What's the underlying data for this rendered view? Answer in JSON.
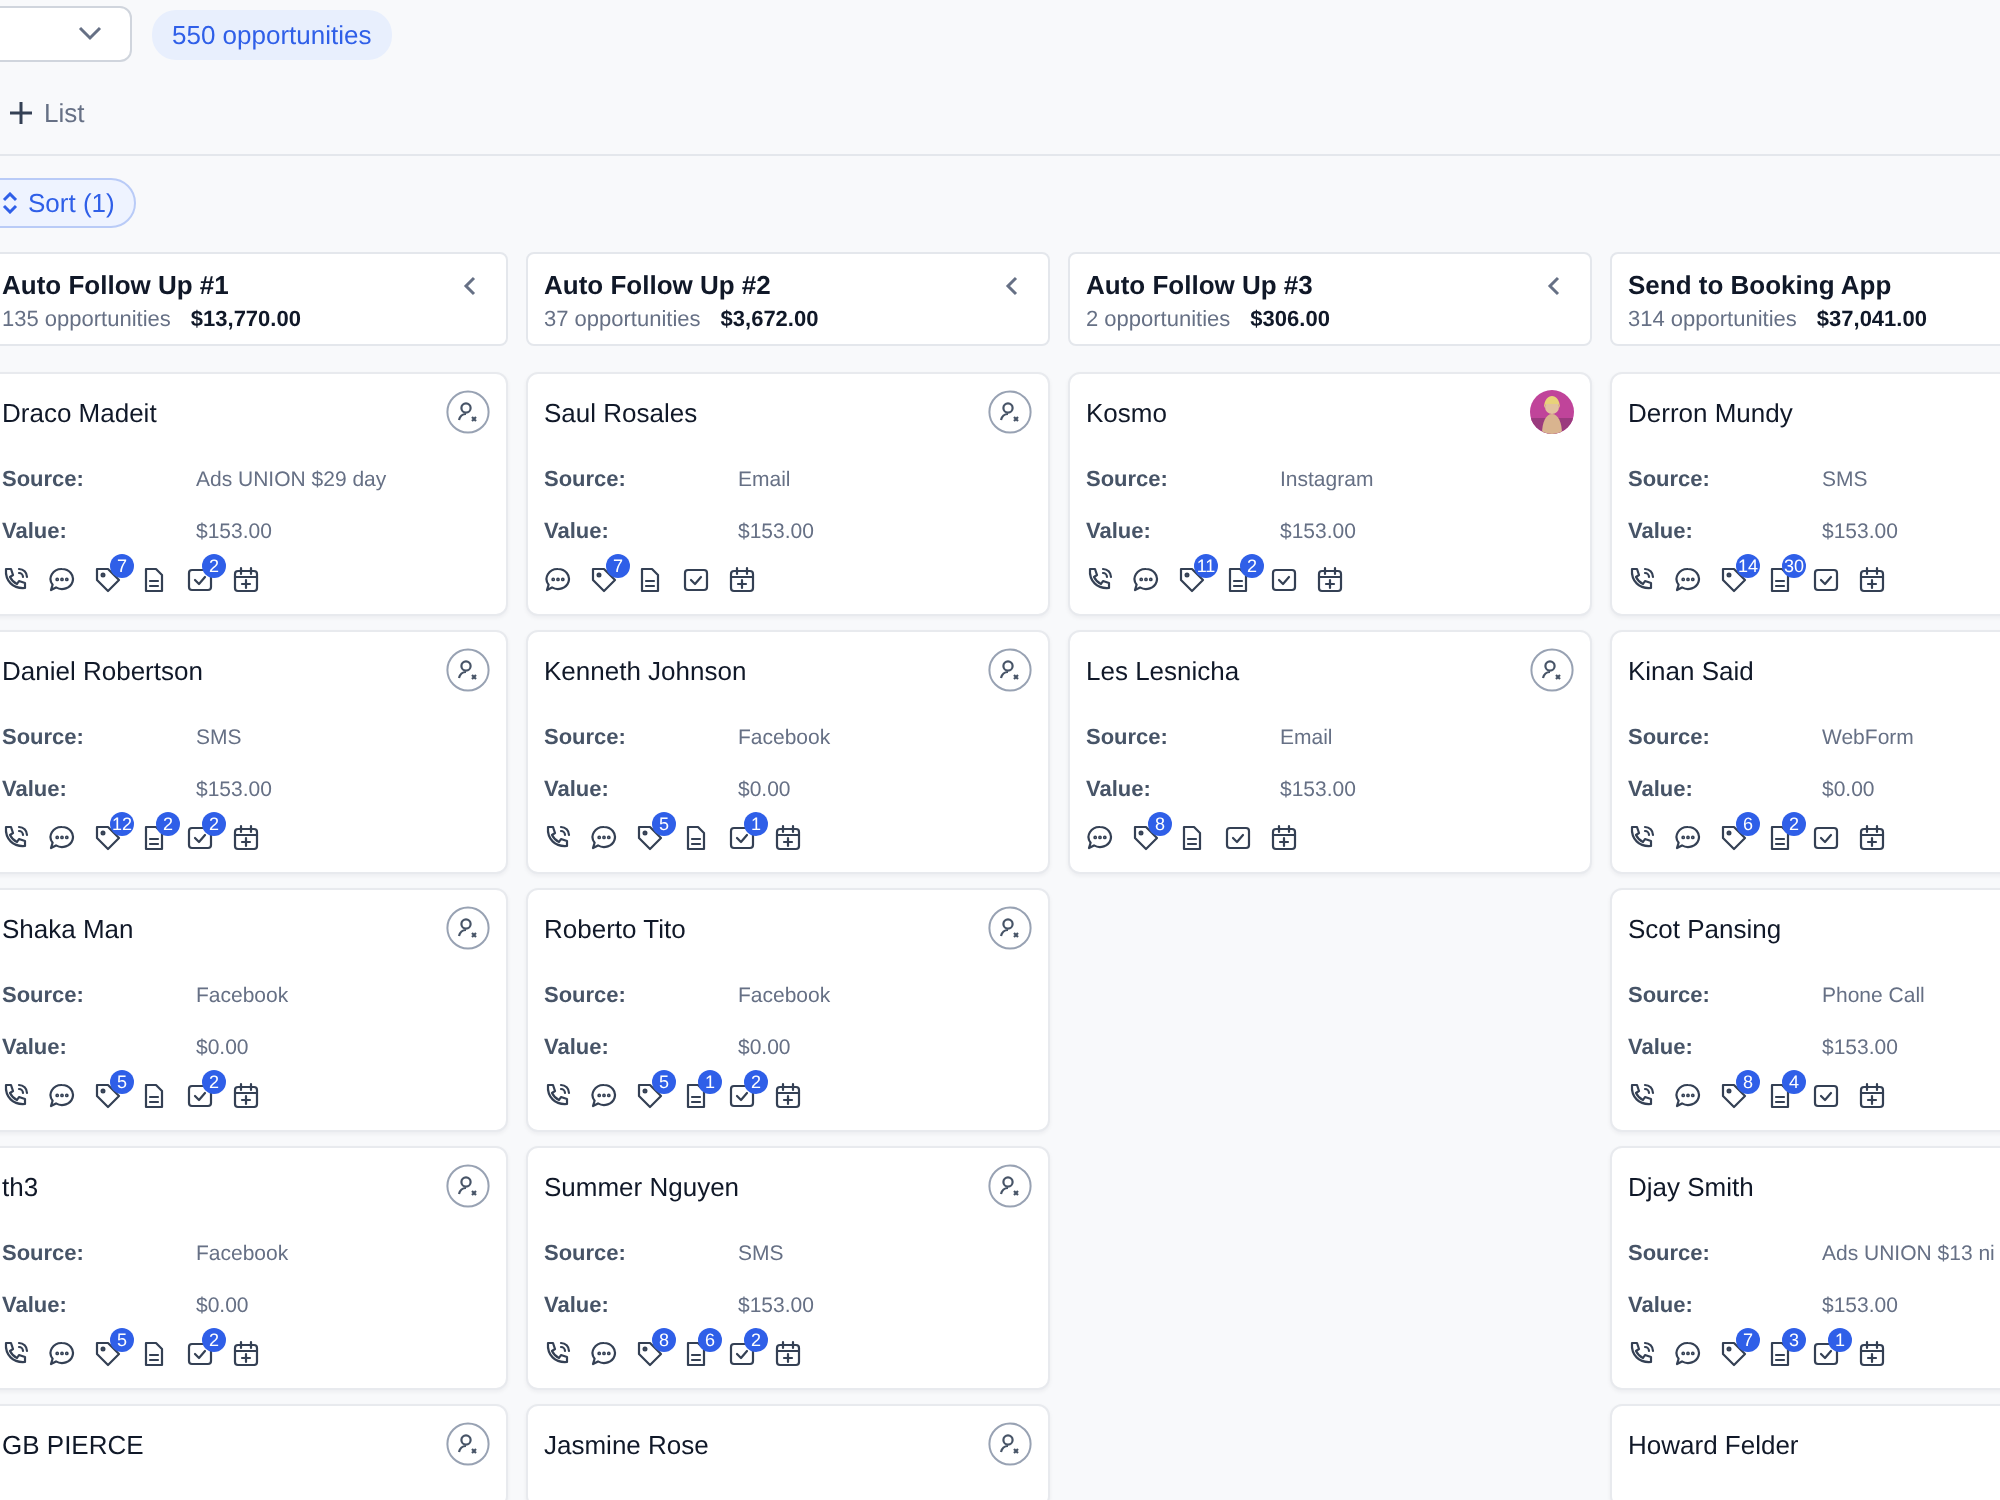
{
  "toolbar": {
    "count_badge": "550 opportunities",
    "add_list": "List",
    "sort": "Sort (1)"
  },
  "columns": [
    {
      "title": "Auto Follow Up #1",
      "count": "135 opportunities",
      "amount": "$13,770.00",
      "cards": [
        {
          "name": "Draco Madeit",
          "avatar": {
            "kind": "assign"
          },
          "source_label": "Source:",
          "source": "Ads UNION $29 day",
          "value_label": "Value:",
          "value": "$153.00",
          "actions": [
            {
              "kind": "phone"
            },
            {
              "kind": "chat"
            },
            {
              "kind": "tag",
              "badge": "7"
            },
            {
              "kind": "note"
            },
            {
              "kind": "task",
              "badge": "2"
            },
            {
              "kind": "calendar"
            }
          ]
        },
        {
          "name": "Daniel Robertson",
          "avatar": {
            "kind": "assign"
          },
          "source_label": "Source:",
          "source": "SMS",
          "value_label": "Value:",
          "value": "$153.00",
          "actions": [
            {
              "kind": "phone"
            },
            {
              "kind": "chat"
            },
            {
              "kind": "tag",
              "badge": "12"
            },
            {
              "kind": "note",
              "badge": "2"
            },
            {
              "kind": "task",
              "badge": "2"
            },
            {
              "kind": "calendar"
            }
          ]
        },
        {
          "name": "Shaka Man",
          "avatar": {
            "kind": "assign"
          },
          "source_label": "Source:",
          "source": "Facebook",
          "value_label": "Value:",
          "value": "$0.00",
          "actions": [
            {
              "kind": "phone"
            },
            {
              "kind": "chat"
            },
            {
              "kind": "tag",
              "badge": "5"
            },
            {
              "kind": "note"
            },
            {
              "kind": "task",
              "badge": "2"
            },
            {
              "kind": "calendar"
            }
          ]
        },
        {
          "name": "th3",
          "avatar": {
            "kind": "assign"
          },
          "source_label": "Source:",
          "source": "Facebook",
          "value_label": "Value:",
          "value": "$0.00",
          "actions": [
            {
              "kind": "phone"
            },
            {
              "kind": "chat"
            },
            {
              "kind": "tag",
              "badge": "5"
            },
            {
              "kind": "note"
            },
            {
              "kind": "task",
              "badge": "2"
            },
            {
              "kind": "calendar"
            }
          ]
        },
        {
          "name": "GB PIERCE",
          "avatar": {
            "kind": "assign"
          }
        }
      ]
    },
    {
      "title": "Auto Follow Up #2",
      "count": "37 opportunities",
      "amount": "$3,672.00",
      "cards": [
        {
          "name": "Saul Rosales",
          "avatar": {
            "kind": "assign"
          },
          "source_label": "Source:",
          "source": "Email",
          "value_label": "Value:",
          "value": "$153.00",
          "actions": [
            {
              "kind": "chat"
            },
            {
              "kind": "tag",
              "badge": "7"
            },
            {
              "kind": "note"
            },
            {
              "kind": "task"
            },
            {
              "kind": "calendar"
            }
          ]
        },
        {
          "name": "Kenneth Johnson",
          "avatar": {
            "kind": "assign"
          },
          "source_label": "Source:",
          "source": "Facebook",
          "value_label": "Value:",
          "value": "$0.00",
          "actions": [
            {
              "kind": "phone"
            },
            {
              "kind": "chat"
            },
            {
              "kind": "tag",
              "badge": "5"
            },
            {
              "kind": "note"
            },
            {
              "kind": "task",
              "badge": "1"
            },
            {
              "kind": "calendar"
            }
          ]
        },
        {
          "name": "Roberto Tito",
          "avatar": {
            "kind": "assign"
          },
          "source_label": "Source:",
          "source": "Facebook",
          "value_label": "Value:",
          "value": "$0.00",
          "actions": [
            {
              "kind": "phone"
            },
            {
              "kind": "chat"
            },
            {
              "kind": "tag",
              "badge": "5"
            },
            {
              "kind": "note",
              "badge": "1"
            },
            {
              "kind": "task",
              "badge": "2"
            },
            {
              "kind": "calendar"
            }
          ]
        },
        {
          "name": "Summer Nguyen",
          "avatar": {
            "kind": "assign"
          },
          "source_label": "Source:",
          "source": "SMS",
          "value_label": "Value:",
          "value": "$153.00",
          "actions": [
            {
              "kind": "phone"
            },
            {
              "kind": "chat"
            },
            {
              "kind": "tag",
              "badge": "8"
            },
            {
              "kind": "note",
              "badge": "6"
            },
            {
              "kind": "task",
              "badge": "2"
            },
            {
              "kind": "calendar"
            }
          ]
        },
        {
          "name": "Jasmine Rose",
          "avatar": {
            "kind": "assign"
          }
        }
      ]
    },
    {
      "title": "Auto Follow Up #3",
      "count": "2 opportunities",
      "amount": "$306.00",
      "cards": [
        {
          "name": "Kosmo",
          "source_label": "Source:",
          "source": "Instagram",
          "value_label": "Value:",
          "value": "$153.00",
          "actions": [
            {
              "kind": "phone"
            },
            {
              "kind": "chat"
            },
            {
              "kind": "tag",
              "badge": "11"
            },
            {
              "kind": "note",
              "badge": "2"
            },
            {
              "kind": "task"
            },
            {
              "kind": "calendar"
            }
          ]
        },
        {
          "name": "Les Lesnicha",
          "avatar": {
            "kind": "assign"
          },
          "source_label": "Source:",
          "source": "Email",
          "value_label": "Value:",
          "value": "$153.00",
          "actions": [
            {
              "kind": "chat"
            },
            {
              "kind": "tag",
              "badge": "8"
            },
            {
              "kind": "note"
            },
            {
              "kind": "task"
            },
            {
              "kind": "calendar"
            }
          ]
        }
      ]
    },
    {
      "title": "Send to Booking App",
      "count": "314 opportunities",
      "amount": "$37,041.00",
      "cards": [
        {
          "name": "Derron Mundy",
          "source_label": "Source:",
          "source": "SMS",
          "value_label": "Value:",
          "value": "$153.00",
          "actions": [
            {
              "kind": "phone"
            },
            {
              "kind": "chat"
            },
            {
              "kind": "tag",
              "badge": "14"
            },
            {
              "kind": "note",
              "badge": "30"
            },
            {
              "kind": "task"
            },
            {
              "kind": "calendar"
            }
          ]
        },
        {
          "name": "Kinan Said",
          "source_label": "Source:",
          "source": "WebForm",
          "value_label": "Value:",
          "value": "$0.00",
          "actions": [
            {
              "kind": "phone"
            },
            {
              "kind": "chat"
            },
            {
              "kind": "tag",
              "badge": "6"
            },
            {
              "kind": "note",
              "badge": "2"
            },
            {
              "kind": "task"
            },
            {
              "kind": "calendar"
            }
          ]
        },
        {
          "name": "Scot Pansing",
          "source_label": "Source:",
          "source": "Phone Call",
          "value_label": "Value:",
          "value": "$153.00",
          "actions": [
            {
              "kind": "phone"
            },
            {
              "kind": "chat"
            },
            {
              "kind": "tag",
              "badge": "8"
            },
            {
              "kind": "note",
              "badge": "4"
            },
            {
              "kind": "task"
            },
            {
              "kind": "calendar"
            }
          ]
        },
        {
          "name": "Djay Smith",
          "source_label": "Source:",
          "source": "Ads UNION $13 ni",
          "value_label": "Value:",
          "value": "$153.00",
          "actions": [
            {
              "kind": "phone"
            },
            {
              "kind": "chat"
            },
            {
              "kind": "tag",
              "badge": "7"
            },
            {
              "kind": "note",
              "badge": "3"
            },
            {
              "kind": "task",
              "badge": "1"
            },
            {
              "kind": "calendar"
            }
          ]
        },
        {
          "name": "Howard Felder"
        }
      ]
    }
  ]
}
